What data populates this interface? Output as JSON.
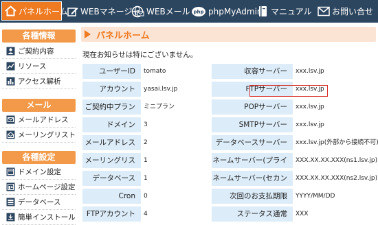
{
  "nav": {
    "items": [
      {
        "label": "パネルホーム",
        "icon": "home-icon"
      },
      {
        "label": "WEBマネージャ",
        "icon": "edit-icon"
      },
      {
        "label": "WEBメール",
        "icon": "globe-mail-icon"
      },
      {
        "label": "phpMyAdmin",
        "icon": "php-icon"
      },
      {
        "label": "マニュアル",
        "icon": "book-icon"
      },
      {
        "label": "お問い合せ",
        "icon": "envelope-icon"
      }
    ]
  },
  "sidebar": {
    "sections": [
      {
        "header": "各種情報",
        "items": [
          {
            "label": "ご契約内容",
            "icon": "contract-icon"
          },
          {
            "label": "リソース",
            "icon": "line-chart-icon"
          },
          {
            "label": "アクセス解析",
            "icon": "bar-chart-icon"
          }
        ]
      },
      {
        "header": "メール",
        "items": [
          {
            "label": "メールアドレス",
            "icon": "mail-icon"
          },
          {
            "label": "メーリングリスト",
            "icon": "mailing-list-icon"
          }
        ]
      },
      {
        "header": "各種設定",
        "items": [
          {
            "label": "ドメイン設定",
            "icon": "domain-icon"
          },
          {
            "label": "ホームページ設定",
            "icon": "homepage-icon"
          },
          {
            "label": "データベース",
            "icon": "database-icon"
          },
          {
            "label": "簡単インストール",
            "icon": "install-icon"
          }
        ]
      }
    ]
  },
  "main": {
    "title": "パネルホーム",
    "notice": "現在お知らせは特にございません。",
    "rows": [
      {
        "l1": "ユーザーID",
        "v1": "tomato",
        "l2": "収容サーバー",
        "v2": "xxx.lsv.jp"
      },
      {
        "l1": "アカウント",
        "v1": "yasai.lsv.jp",
        "l2": "FTPサーバー",
        "v2": "xxx.lsv.jp"
      },
      {
        "l1": "ご契約中プラン",
        "v1": "ミニプラン",
        "l2": "POPサーバー",
        "v2": "xxx.lsv.jp"
      },
      {
        "l1": "ドメイン",
        "v1": "3",
        "l2": "SMTPサーバー",
        "v2": "xxx.lsv.jp"
      },
      {
        "l1": "メールアドレス",
        "v1": "2",
        "l2": "データベースサーバー",
        "v2": "xxx.lsv.jp(外部から接続不可)"
      },
      {
        "l1": "メーリングリスト",
        "v1": "1",
        "l2": "ネームサーバー(プライマリ)",
        "v2": "XXX.XX.XX.XXX(ns1.lsv.jp)"
      },
      {
        "l1": "データベース",
        "v1": "1",
        "l2": "ネームサーバー(セカンダリ)",
        "v2": "XXX.XX.XX.XXX(ns2.lsv.jp)"
      },
      {
        "l1": "Cron",
        "v1": "0",
        "l2": "次回のお支払期限",
        "v2": "YYYY/MM/DD"
      },
      {
        "l1": "FTPアカウント",
        "v1": "4",
        "l2": "ステータス通常",
        "v2": "XXX"
      }
    ]
  },
  "colors": {
    "nav_bg": "#2d4660",
    "accent": "#ee7a22",
    "label_bg": "#dcecf8",
    "highlight": "#d9322b"
  }
}
